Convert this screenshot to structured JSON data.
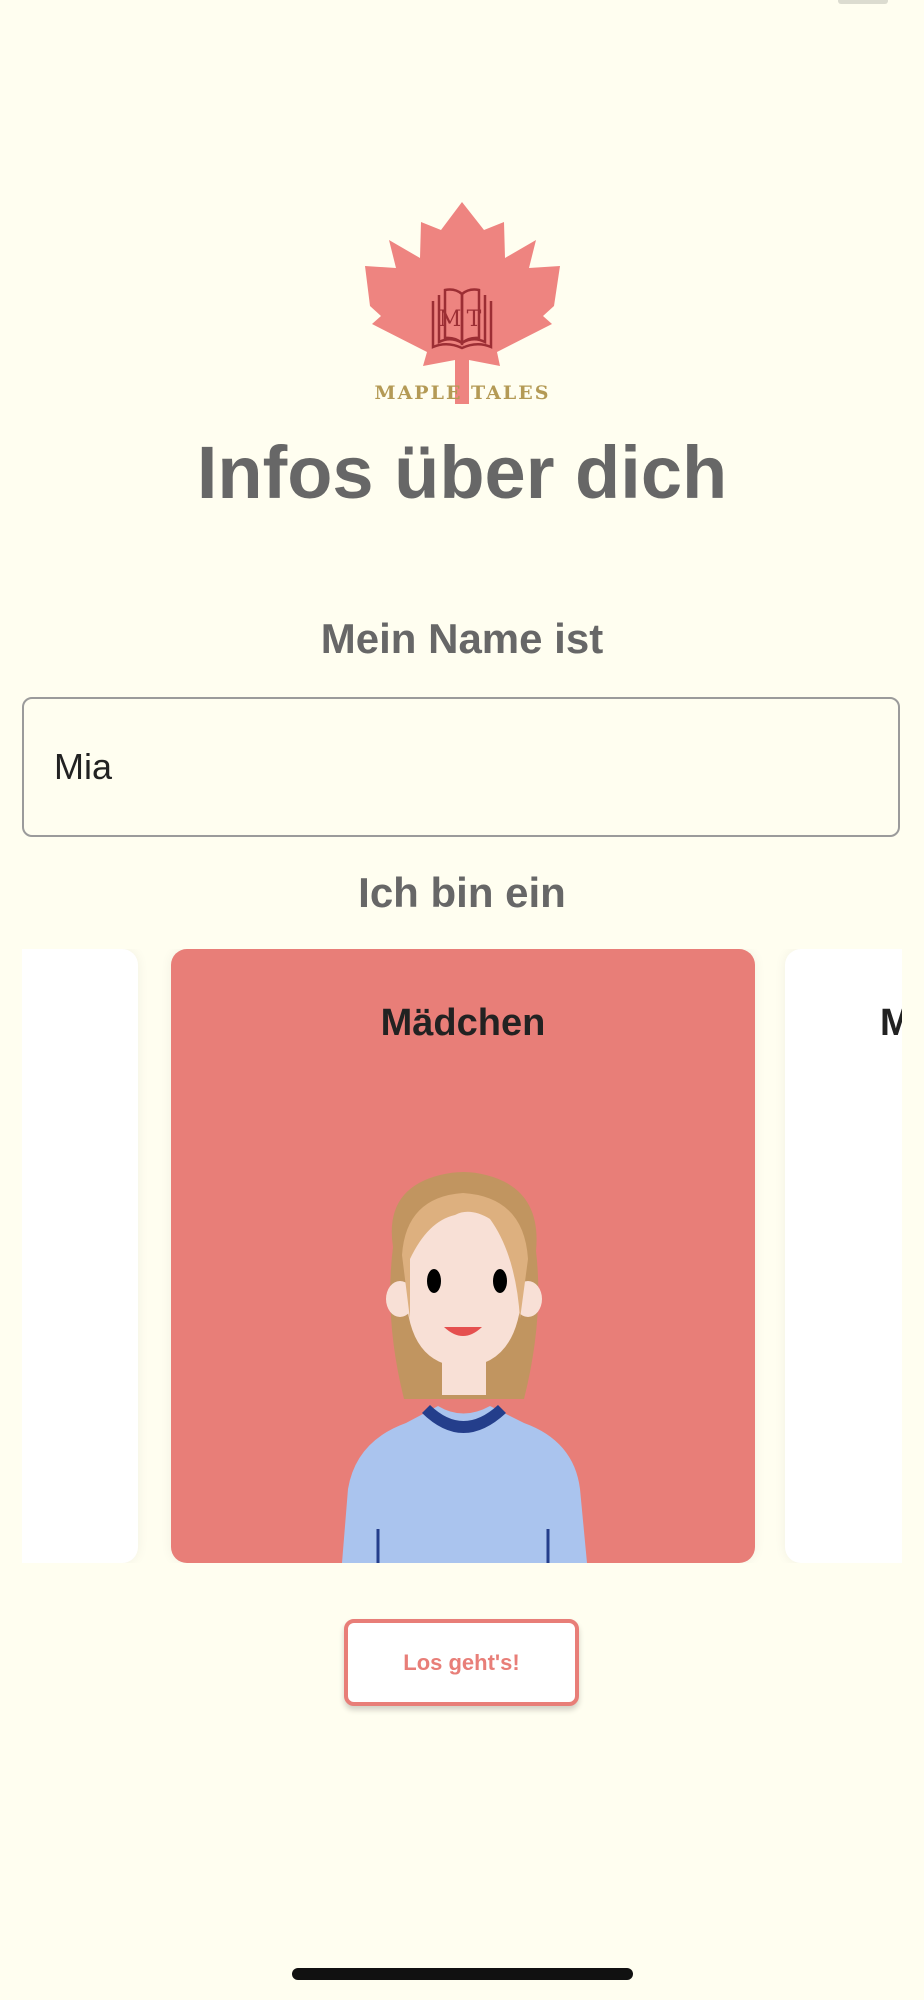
{
  "logo": {
    "monogram": "MT",
    "wordmark": "MAPLE TALES",
    "icon": "maple-leaf-book-icon",
    "colors": {
      "leaf": "#ee8480",
      "book": "#9c2e34",
      "wordmark": "#b49a55"
    }
  },
  "page": {
    "title": "Infos über dich"
  },
  "name_section": {
    "label": "Mein Name ist",
    "value": "Mia"
  },
  "gender_section": {
    "label": "Ich bin ein",
    "options": [
      {
        "label": "",
        "selected": false
      },
      {
        "label": "Mädchen",
        "selected": true,
        "avatar": "girl-avatar-icon"
      },
      {
        "label": "Mädchen",
        "selected": false
      }
    ]
  },
  "cta": {
    "label": "Los geht's!"
  },
  "colors": {
    "background": "#fffef0",
    "accent": "#e87e78",
    "text": "#676767"
  }
}
